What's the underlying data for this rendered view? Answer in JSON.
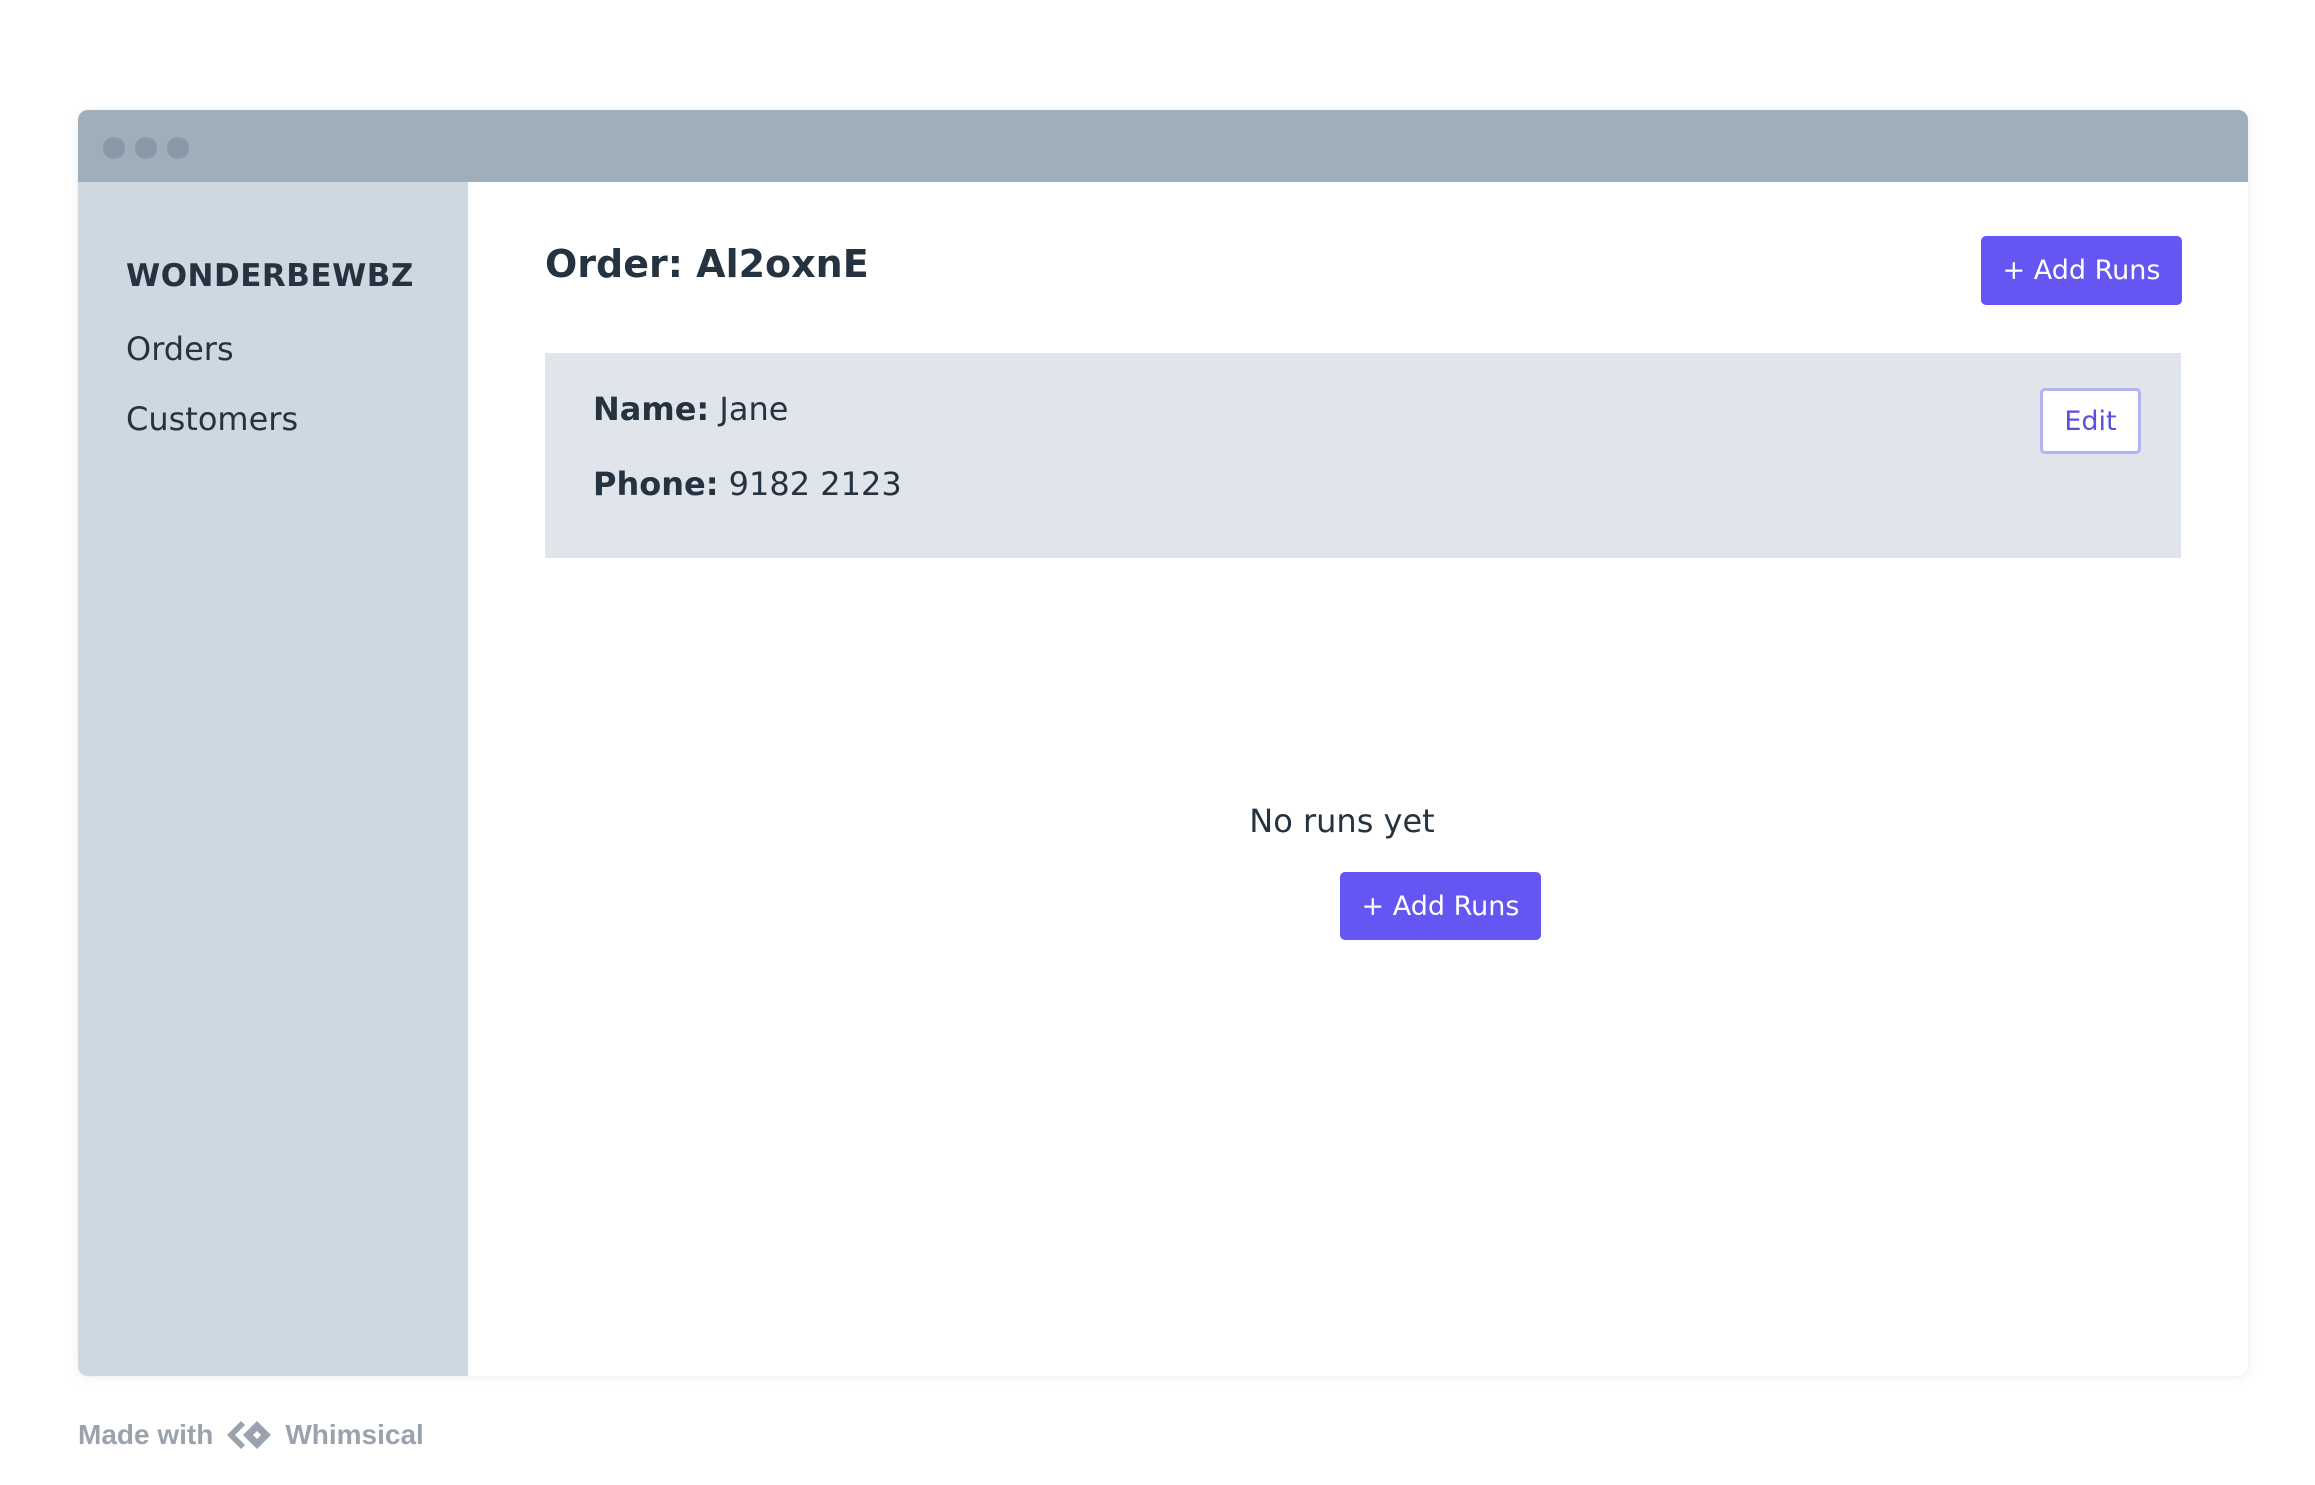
{
  "brand": "WONDERBEWBZ",
  "sidebar": {
    "items": [
      {
        "label": "Orders"
      },
      {
        "label": "Customers"
      }
    ]
  },
  "page": {
    "title": "Order: Al2oxnE",
    "add_runs_label": "+ Add Runs"
  },
  "customer": {
    "name_label": "Name:",
    "name_value": "Jane",
    "phone_label": "Phone:",
    "phone_value": "9182 2123",
    "edit_label": "Edit"
  },
  "empty_state": {
    "message": "No runs yet",
    "add_runs_label": "+ Add Runs"
  },
  "footer": {
    "made_with": "Made with",
    "logo_text": "Whimsical"
  },
  "colors": {
    "accent": "#6356f2",
    "sidebar_bg": "#ced8e0",
    "titlebar_bg": "#9eaebb",
    "card_bg": "#e0e5ec",
    "text": "#253340"
  },
  "icons": {
    "window_controls": "traffic-light-dots",
    "footer_logo": "whimsical-logo-icon"
  }
}
